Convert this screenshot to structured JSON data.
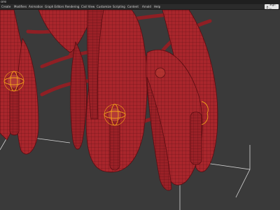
{
  "window": {
    "title": "ore"
  },
  "menu": {
    "items": [
      "Create",
      "Modifiers",
      "Animation",
      "Graph Editors",
      "Rendering",
      "Civil View",
      "Customize",
      "Scripting",
      "Content",
      "Arnold",
      "Help"
    ]
  },
  "account": {
    "signin_label": "Sign In",
    "icon": "user-icon"
  },
  "viewport": {
    "background": "#3a3a3a",
    "mesh_color": "#a5272c",
    "wire_color": "#5a0d12",
    "gizmo_color": "#f2a21a",
    "bounding_box_color": "#d7d7d7"
  }
}
